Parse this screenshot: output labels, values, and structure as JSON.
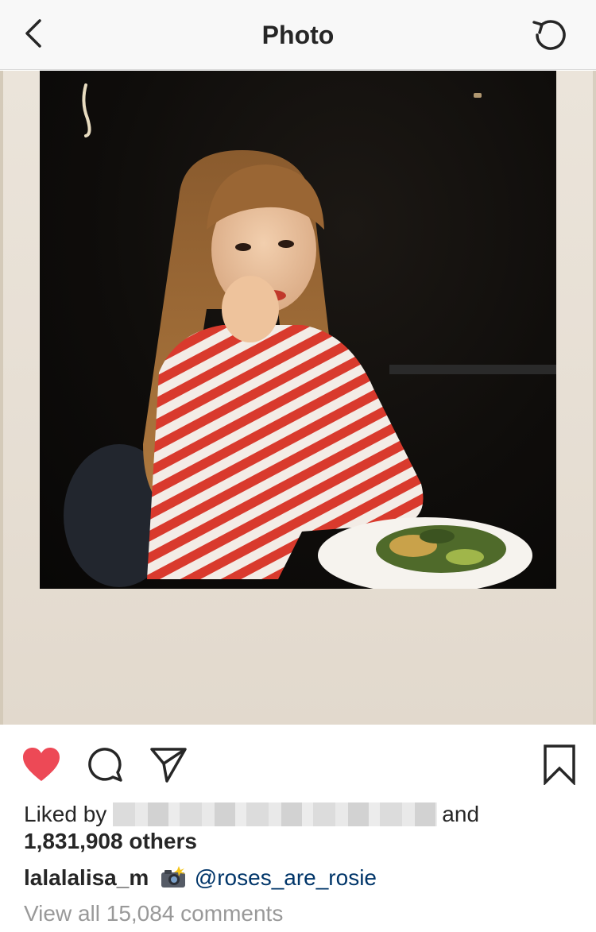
{
  "header": {
    "title": "Photo",
    "back_icon": "chevron-left-icon",
    "refresh_icon": "refresh-icon"
  },
  "post": {
    "image_alt": "Polaroid photo of a person in a red and white striped sweater at a table with a salad",
    "liked": true,
    "like_icon": "heart-filled-icon",
    "like_color": "#ed4956",
    "comment_icon": "comment-icon",
    "share_icon": "paper-plane-icon",
    "save_icon": "bookmark-icon",
    "likes": {
      "prefix": "Liked by",
      "suffix": "and",
      "count_text": "1,831,908 others"
    },
    "caption": {
      "username": "lalalalisa_m",
      "emoji_icon": "camera-flash-icon",
      "mention": "@roses_are_rosie"
    },
    "view_comments": "View all 15,084 comments"
  },
  "colors": {
    "mention": "#003569",
    "muted": "#999999",
    "text": "#262626"
  }
}
